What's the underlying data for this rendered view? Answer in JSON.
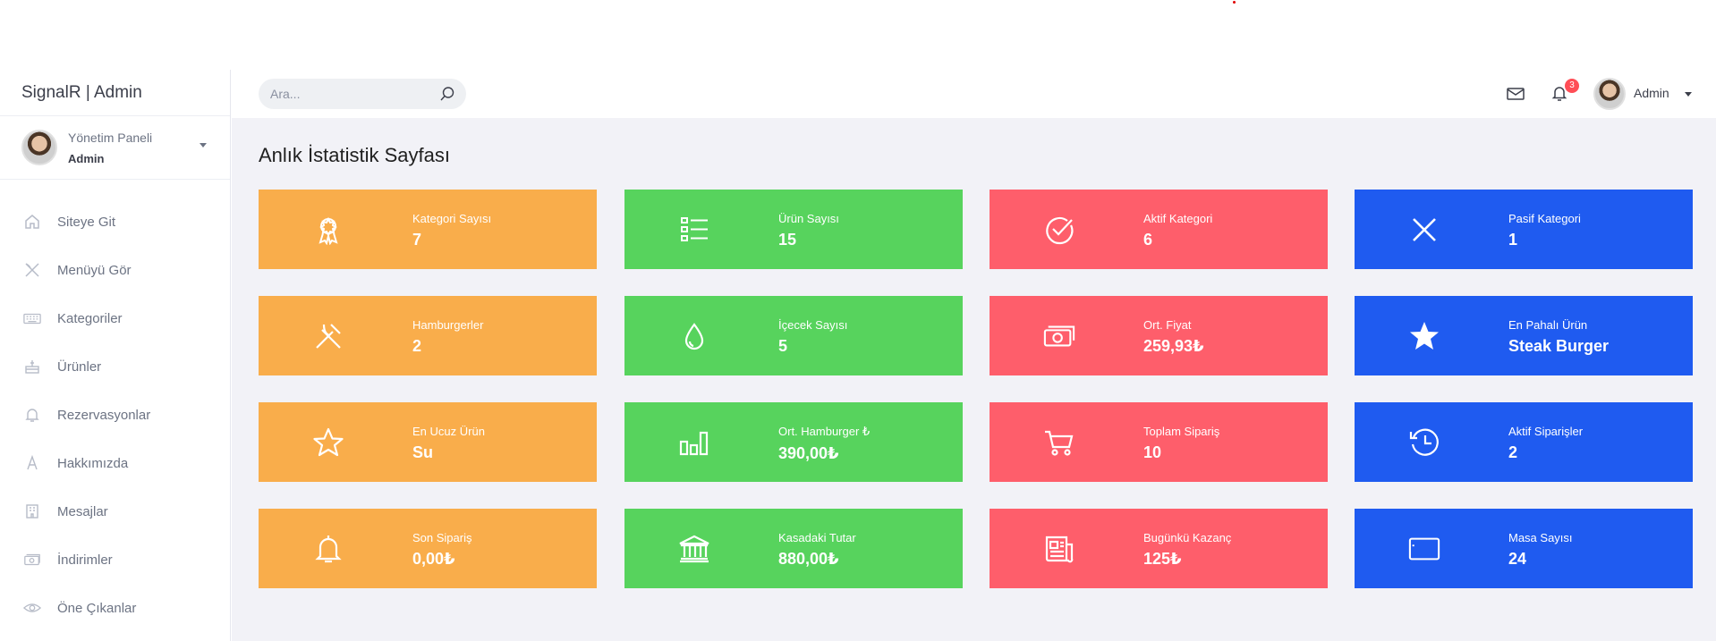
{
  "brand": "SignalR | Admin",
  "profile": {
    "title": "Yönetim Paneli",
    "subtitle": "Admin"
  },
  "menu": [
    {
      "label": "Siteye Git",
      "icon": "home-icon"
    },
    {
      "label": "Menüyü Gör",
      "icon": "utensils-icon"
    },
    {
      "label": "Kategoriler",
      "icon": "keyboard-icon"
    },
    {
      "label": "Ürünler",
      "icon": "cake-icon"
    },
    {
      "label": "Rezervasyonlar",
      "icon": "bell-icon"
    },
    {
      "label": "Hakkımızda",
      "icon": "letter-a-icon"
    },
    {
      "label": "Mesajlar",
      "icon": "building-icon"
    },
    {
      "label": "İndirimler",
      "icon": "money-icon"
    },
    {
      "label": "Öne Çıkanlar",
      "icon": "eye-icon"
    }
  ],
  "search": {
    "placeholder": "Ara..."
  },
  "topbar": {
    "notification_count": "3",
    "user_name": "Admin"
  },
  "page_title": "Anlık İstatistik Sayfası",
  "colors": {
    "orange": "#f9ad4b",
    "green": "#57d35d",
    "red": "#fe5e6b",
    "blue": "#1f5bf0"
  },
  "cards": [
    {
      "label": "Kategori Sayısı",
      "value": "7",
      "icon": "award-icon",
      "color": "orange"
    },
    {
      "label": "Ürün Sayısı",
      "value": "15",
      "icon": "list-icon",
      "color": "green"
    },
    {
      "label": "Aktif Kategori",
      "value": "6",
      "icon": "check-circle-icon",
      "color": "red"
    },
    {
      "label": "Pasif Kategori",
      "value": "1",
      "icon": "close-icon",
      "color": "blue"
    },
    {
      "label": "Hamburgerler",
      "value": "2",
      "icon": "utensils-icon",
      "color": "orange"
    },
    {
      "label": "İçecek Sayısı",
      "value": "5",
      "icon": "drop-icon",
      "color": "green"
    },
    {
      "label": "Ort. Fiyat",
      "value": "259,93₺",
      "icon": "money-icon",
      "color": "red"
    },
    {
      "label": "En Pahalı Ürün",
      "value": "Steak Burger",
      "icon": "star-filled-icon",
      "color": "blue"
    },
    {
      "label": "En Ucuz Ürün",
      "value": "Su",
      "icon": "star-outline-icon",
      "color": "orange"
    },
    {
      "label": "Ort. Hamburger ₺",
      "value": "390,00₺",
      "icon": "bar-chart-icon",
      "color": "green"
    },
    {
      "label": "Toplam Sipariş",
      "value": "10",
      "icon": "cart-icon",
      "color": "red"
    },
    {
      "label": "Aktif Siparişler",
      "value": "2",
      "icon": "history-icon",
      "color": "blue"
    },
    {
      "label": "Son Sipariş",
      "value": "0,00₺",
      "icon": "bell-icon",
      "color": "orange"
    },
    {
      "label": "Kasadaki Tutar",
      "value": "880,00₺",
      "icon": "bank-icon",
      "color": "green"
    },
    {
      "label": "Bugünkü Kazanç",
      "value": "125₺",
      "icon": "newspaper-icon",
      "color": "red"
    },
    {
      "label": "Masa Sayısı",
      "value": "24",
      "icon": "tablet-icon",
      "color": "blue"
    }
  ]
}
